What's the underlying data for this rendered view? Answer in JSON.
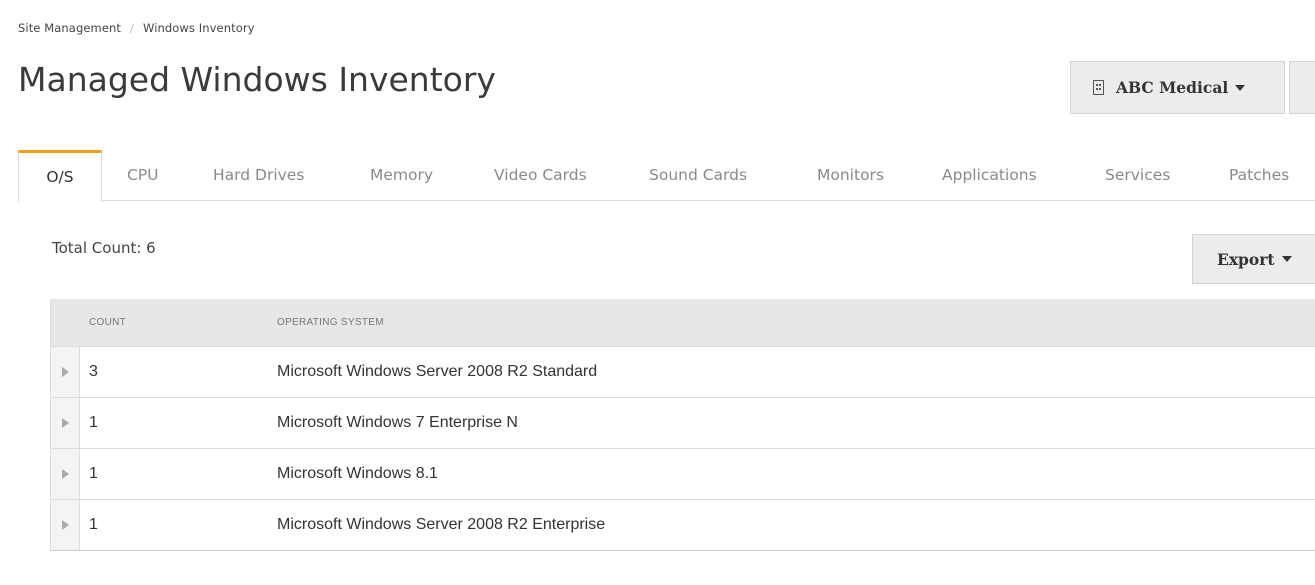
{
  "breadcrumb": {
    "items": [
      "Site Management",
      "Windows Inventory"
    ],
    "separator": "/"
  },
  "page_title": "Managed Windows Inventory",
  "site_selector": {
    "label": "ABC Medical",
    "icon": "building-icon"
  },
  "tabs": [
    {
      "label": "O/S",
      "active": true
    },
    {
      "label": "CPU",
      "active": false
    },
    {
      "label": "Hard Drives",
      "active": false
    },
    {
      "label": "Memory",
      "active": false
    },
    {
      "label": "Video Cards",
      "active": false
    },
    {
      "label": "Sound Cards",
      "active": false
    },
    {
      "label": "Monitors",
      "active": false
    },
    {
      "label": "Applications",
      "active": false
    },
    {
      "label": "Services",
      "active": false
    },
    {
      "label": "Patches",
      "active": false
    }
  ],
  "total_count": "Total Count: 6",
  "export": {
    "label": "Export"
  },
  "table": {
    "columns": [
      "COUNT",
      "OPERATING SYSTEM"
    ],
    "rows": [
      {
        "count": "3",
        "os": "Microsoft Windows Server 2008 R2 Standard"
      },
      {
        "count": "1",
        "os": "Microsoft Windows 7 Enterprise N"
      },
      {
        "count": "1",
        "os": "Microsoft Windows 8.1"
      },
      {
        "count": "1",
        "os": "Microsoft Windows Server 2008 R2 Enterprise"
      }
    ]
  },
  "colors": {
    "active_tab_accent": "#f0a01c",
    "header_background": "#e7e7e7",
    "button_background": "#ececec"
  }
}
